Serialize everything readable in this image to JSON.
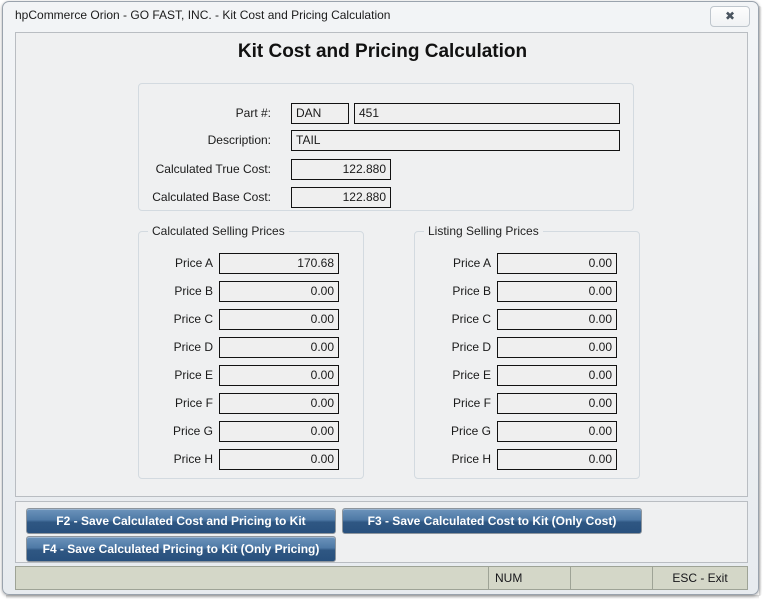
{
  "window": {
    "title": "hpCommerce Orion - GO FAST, INC. - Kit Cost and Pricing Calculation",
    "close_glyph": "✖"
  },
  "page": {
    "heading": "Kit Cost and Pricing Calculation"
  },
  "header_group": {
    "fields": [
      {
        "label": "Part #:",
        "value": "DAN"
      },
      {
        "label": "",
        "value": "451"
      },
      {
        "label": "Description:",
        "value": "TAIL"
      },
      {
        "label": "Calculated True Cost:",
        "value": "122.880"
      },
      {
        "label": "Calculated Base Cost:",
        "value": "122.880"
      }
    ]
  },
  "calculated_selling_prices": {
    "title": "Calculated Selling Prices",
    "rows": [
      {
        "label": "Price A",
        "value": "170.68"
      },
      {
        "label": "Price B",
        "value": "0.00"
      },
      {
        "label": "Price C",
        "value": "0.00"
      },
      {
        "label": "Price D",
        "value": "0.00"
      },
      {
        "label": "Price E",
        "value": "0.00"
      },
      {
        "label": "Price F",
        "value": "0.00"
      },
      {
        "label": "Price G",
        "value": "0.00"
      },
      {
        "label": "Price H",
        "value": "0.00"
      }
    ]
  },
  "listing_selling_prices": {
    "title": "Listing Selling Prices",
    "rows": [
      {
        "label": "Price A",
        "value": "0.00"
      },
      {
        "label": "Price B",
        "value": "0.00"
      },
      {
        "label": "Price C",
        "value": "0.00"
      },
      {
        "label": "Price D",
        "value": "0.00"
      },
      {
        "label": "Price E",
        "value": "0.00"
      },
      {
        "label": "Price F",
        "value": "0.00"
      },
      {
        "label": "Price G",
        "value": "0.00"
      },
      {
        "label": "Price H",
        "value": "0.00"
      }
    ]
  },
  "buttons": {
    "f2": "F2 - Save Calculated Cost and Pricing to Kit",
    "f3": "F3 - Save Calculated Cost to Kit (Only Cost)",
    "f4": "F4 - Save Calculated Pricing to Kit (Only Pricing)"
  },
  "statusbar": {
    "main": "",
    "num": "NUM",
    "blank": "",
    "esc": "ESC - Exit"
  },
  "colors": {
    "button_blue_top": "#6c93bb",
    "button_blue_bottom": "#28507d",
    "panel_bg": "#eff0f1",
    "statusbar_bg": "#d4d7c8"
  }
}
